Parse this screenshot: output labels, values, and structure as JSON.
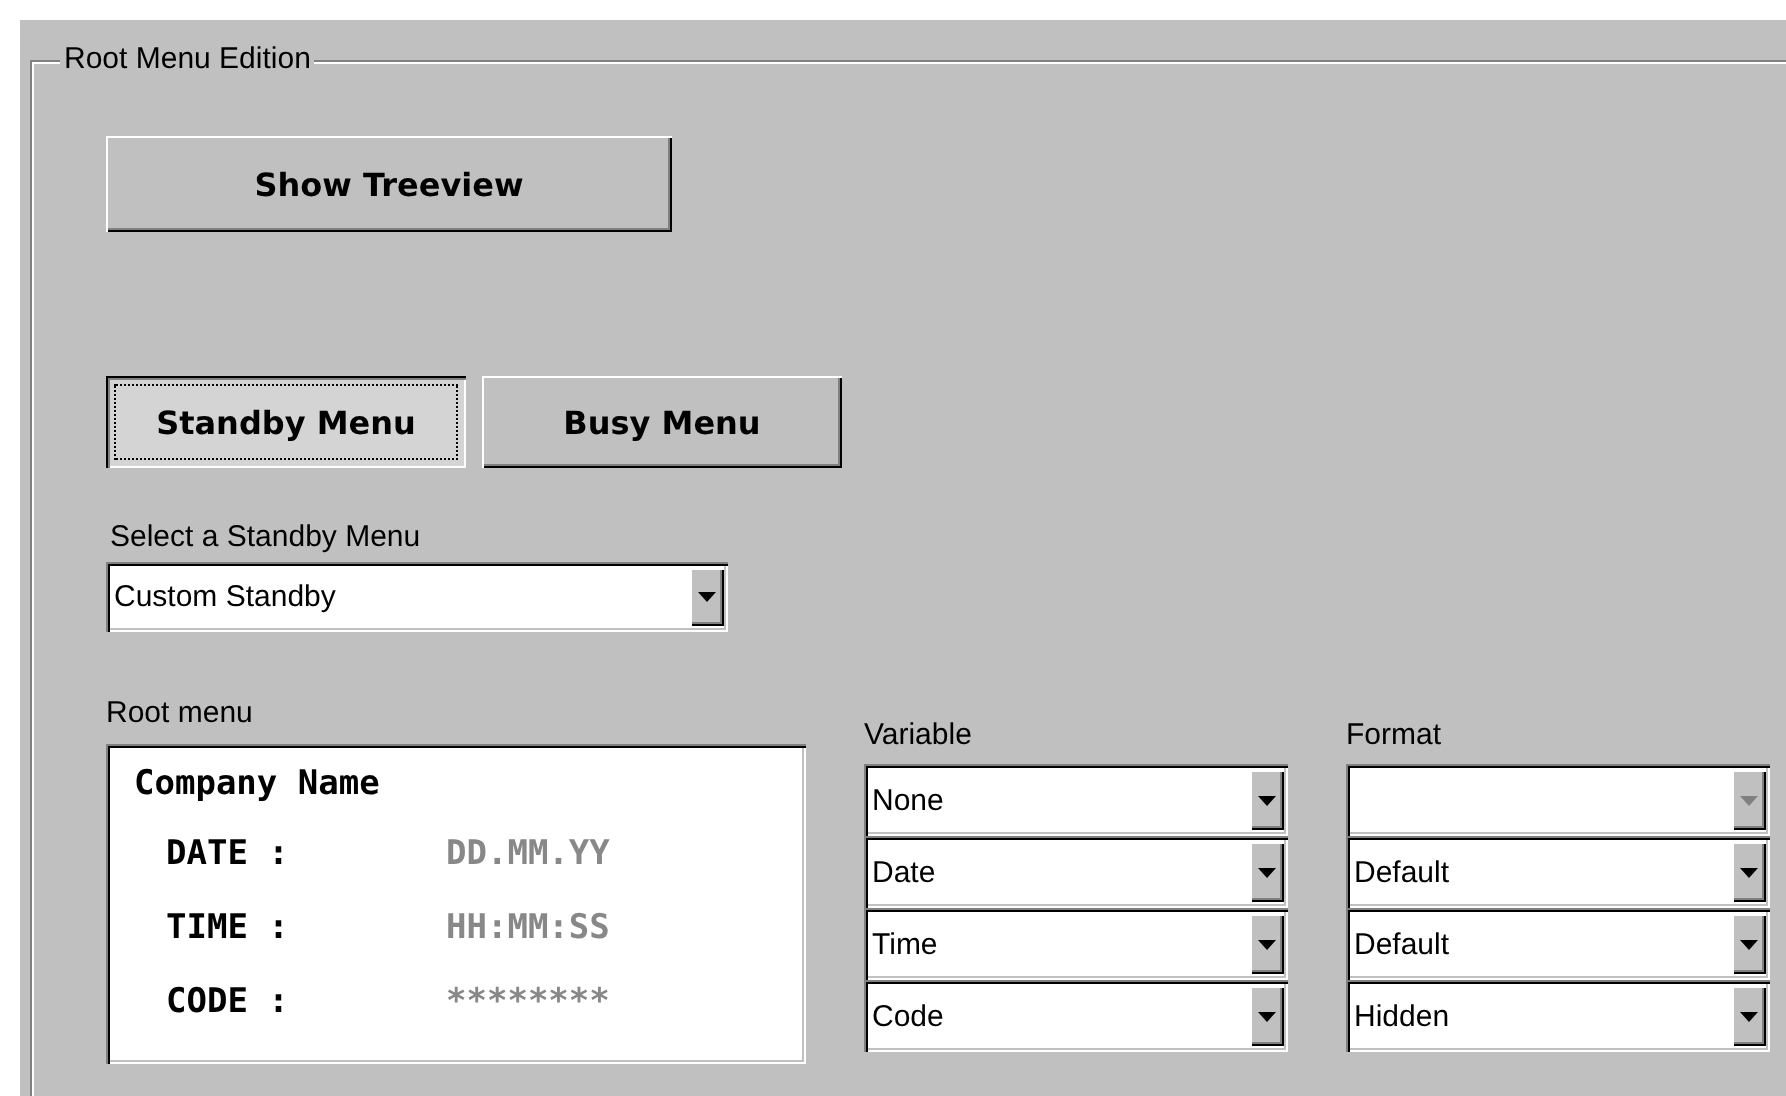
{
  "group": {
    "title": "Root Menu Edition"
  },
  "show_treeview_button": "Show Treeview",
  "menu_tabs": [
    {
      "label": "Standby Menu",
      "selected": true
    },
    {
      "label": "Busy Menu",
      "selected": false
    }
  ],
  "standby_select": {
    "label": "Select a Standby Menu",
    "value": "Custom Standby"
  },
  "root_menu": {
    "label": "Root menu",
    "title": "Company Name",
    "lines": [
      {
        "name": "DATE :",
        "value": "DD.MM.YY"
      },
      {
        "name": "TIME :",
        "value": "HH:MM:SS"
      },
      {
        "name": "CODE :",
        "value": "********"
      }
    ]
  },
  "variable": {
    "label": "Variable",
    "rows": [
      {
        "value": "None",
        "disabled": false
      },
      {
        "value": "Date",
        "disabled": false
      },
      {
        "value": "Time",
        "disabled": false
      },
      {
        "value": "Code",
        "disabled": false
      }
    ]
  },
  "format": {
    "label": "Format",
    "rows": [
      {
        "value": "",
        "disabled": true
      },
      {
        "value": "Default",
        "disabled": false
      },
      {
        "value": "Default",
        "disabled": false
      },
      {
        "value": "Hidden",
        "disabled": false
      }
    ]
  }
}
